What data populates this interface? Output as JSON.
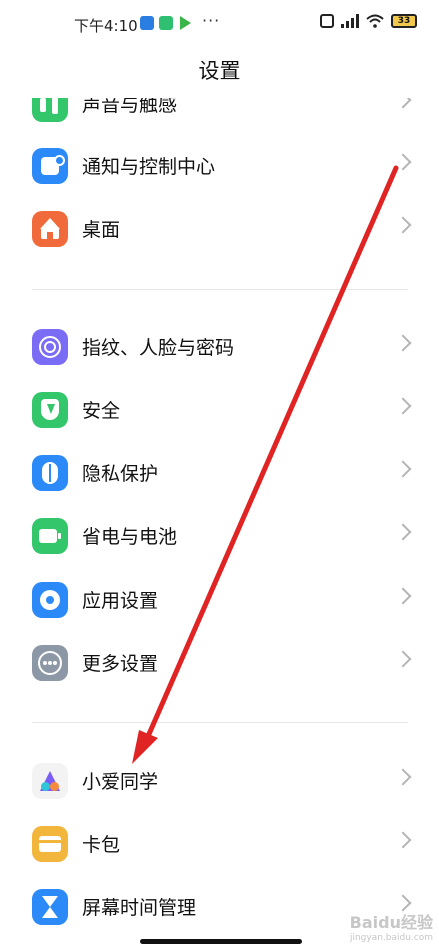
{
  "status_bar": {
    "time": "下午4:10",
    "more": "···",
    "battery": "33"
  },
  "header": {
    "title": "设置"
  },
  "items": [
    {
      "label": "声音与触感",
      "icon": "sound-icon",
      "color": "#34c66b"
    },
    {
      "label": "通知与控制中心",
      "icon": "notification-icon",
      "color": "#2b8af7"
    },
    {
      "label": "桌面",
      "icon": "home-icon",
      "color": "#f06a3b"
    },
    {
      "label": "指纹、人脸与密码",
      "icon": "fingerprint-icon",
      "color": "#7b6cf6"
    },
    {
      "label": "安全",
      "icon": "shield-icon",
      "color": "#34c66b"
    },
    {
      "label": "隐私保护",
      "icon": "privacy-icon",
      "color": "#2b8af7"
    },
    {
      "label": "省电与电池",
      "icon": "battery-icon",
      "color": "#34c66b"
    },
    {
      "label": "应用设置",
      "icon": "gear-icon",
      "color": "#2b8af7"
    },
    {
      "label": "更多设置",
      "icon": "more-icon",
      "color": "#8d98a6"
    },
    {
      "label": "小爱同学",
      "icon": "assistant-icon",
      "color": "#f3f3f3"
    },
    {
      "label": "卡包",
      "icon": "wallet-icon",
      "color": "#f2b63c"
    },
    {
      "label": "屏幕时间管理",
      "icon": "hourglass-icon",
      "color": "#2b8af7"
    }
  ],
  "watermark": {
    "brand": "Baidu经验",
    "url": "jingyan.baidu.com"
  },
  "colors": {
    "arrow": "#e02424"
  }
}
